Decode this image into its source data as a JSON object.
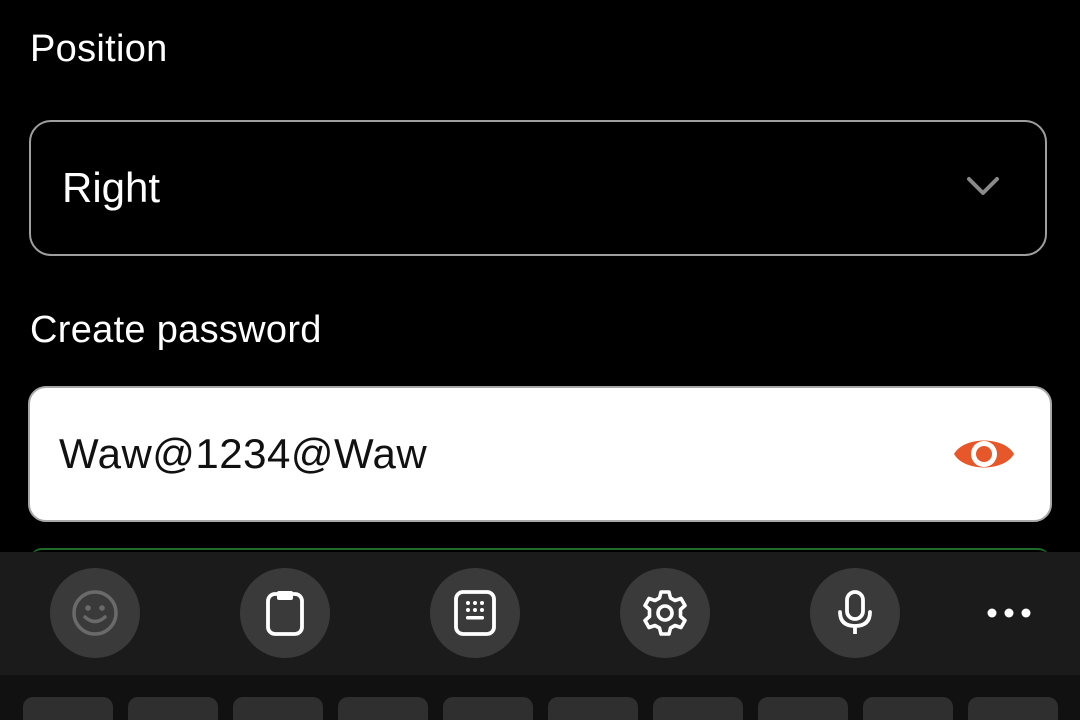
{
  "form": {
    "position_label": "Position",
    "position_value": "Right",
    "password_label": "Create password",
    "password_value": "Waw@1234@Waw"
  },
  "colors": {
    "accent_eye": "#e8572a",
    "background": "#000000",
    "keyboard_toolbar": "#1b1b1b"
  },
  "keyboard": {
    "toolbar_icons": [
      "emoji-icon",
      "clipboard-icon",
      "keypad-icon",
      "settings-icon",
      "microphone-icon",
      "more-icon"
    ]
  }
}
